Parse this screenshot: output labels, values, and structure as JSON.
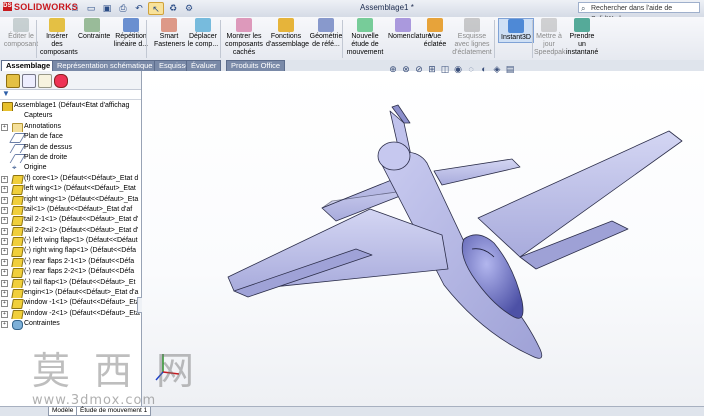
{
  "app": {
    "logo_text": "SOLIDWORKS",
    "window_title": "Assemblage1 *",
    "search_placeholder": "Rechercher dans l'aide de SolidWorks"
  },
  "ribbon": {
    "tools": [
      {
        "id": "edit-component",
        "label": "Éditer le composant",
        "dim": true
      },
      {
        "id": "insert-components",
        "label": "Insérer des composants"
      },
      {
        "id": "mate",
        "label": "Contrainte"
      },
      {
        "id": "linear-pattern",
        "label": "Répétition linéaire d..."
      },
      {
        "id": "smart-fasteners",
        "label": "Smart Fasteners"
      },
      {
        "id": "move-component",
        "label": "Déplacer le comp..."
      },
      {
        "id": "show-hidden",
        "label": "Montrer les composants cachés"
      },
      {
        "id": "assembly-features",
        "label": "Fonctions d'assemblage"
      },
      {
        "id": "reference-geometry",
        "label": "Géométrie de réfé..."
      },
      {
        "id": "new-motion-study",
        "label": "Nouvelle étude de mouvement"
      },
      {
        "id": "bill-of-materials",
        "label": "Nomenclature"
      },
      {
        "id": "exploded-view",
        "label": "Vue éclatée"
      },
      {
        "id": "explode-line-sketch",
        "label": "Esquisse avec lignes d'éclatement",
        "dim": true
      },
      {
        "id": "instant3d",
        "label": "Instant3D",
        "selected": true
      },
      {
        "id": "update-speedpak",
        "label": "Mettre à jour Speedpak",
        "dim": true
      },
      {
        "id": "take-snapshot",
        "label": "Prendre un instantané"
      }
    ]
  },
  "tabs": [
    {
      "label": "Assemblage",
      "active": true
    },
    {
      "label": "Représentation schématique"
    },
    {
      "label": "Esquisse"
    },
    {
      "label": "Évaluer"
    },
    {
      "label": "Produits Office"
    }
  ],
  "tree": {
    "root": "Assemblage1  (Défaut<État d'affichag",
    "items": [
      {
        "type": "folder",
        "label": "Capteurs",
        "exp": false
      },
      {
        "type": "fold",
        "label": "Annotations",
        "exp": true
      },
      {
        "type": "plane",
        "label": "Plan de face",
        "exp": false
      },
      {
        "type": "plane",
        "label": "Plan de dessus",
        "exp": false
      },
      {
        "type": "plane",
        "label": "Plan de droite",
        "exp": false
      },
      {
        "type": "origin",
        "label": "Origine",
        "exp": false
      },
      {
        "type": "part",
        "label": "(f) core<1> (Défaut<<Défaut>_Etat d",
        "exp": true
      },
      {
        "type": "part",
        "label": "left wing<1> (Défaut<<Défaut>_Etat",
        "exp": true
      },
      {
        "type": "part",
        "label": "right wing<1> (Défaut<<Défaut>_Eta",
        "exp": true
      },
      {
        "type": "part",
        "label": "tail<1> (Défaut<<Défaut>_État d'af",
        "exp": true
      },
      {
        "type": "part",
        "label": "tail 2-1<1> (Défaut<<Défaut>_Etat d'",
        "exp": true
      },
      {
        "type": "part",
        "label": "tail 2-2<1> (Défaut<<Défaut>_Etat d'",
        "exp": true
      },
      {
        "type": "part",
        "label": "(-) left wing flap<1> (Défaut<<Défaut",
        "exp": true
      },
      {
        "type": "part",
        "label": "(-) right wing flap<1> (Défaut<<Défa",
        "exp": true
      },
      {
        "type": "part",
        "label": "(-) rear flaps 2-1<1> (Défaut<<Défa",
        "exp": true
      },
      {
        "type": "part",
        "label": "(-) rear flaps 2-2<1> (Défaut<<Défa",
        "exp": true
      },
      {
        "type": "part",
        "label": "(-) tail flap<1> (Défaut<<Défaut>_Et",
        "exp": true
      },
      {
        "type": "part",
        "label": "engin<1> (Défaut<<Défaut>_Etat d'a",
        "exp": true
      },
      {
        "type": "part",
        "label": "window -1<1> (Défaut<<Défaut>_Etat",
        "exp": true
      },
      {
        "type": "part",
        "label": "window -2<1> (Défaut<<Défaut>_Eta",
        "exp": true
      },
      {
        "type": "mate",
        "label": "Contraintes",
        "exp": true
      }
    ]
  },
  "bottom_tabs": {
    "model": "Modèle",
    "motion": "Étude de mouvement 1"
  },
  "watermark": {
    "cn": "莫西网",
    "url": "www.3dmox.com"
  },
  "colors": {
    "plane_body": "#b7b9e6",
    "plane_edge": "#2c2e4a",
    "canopy": "#6f73c8"
  }
}
